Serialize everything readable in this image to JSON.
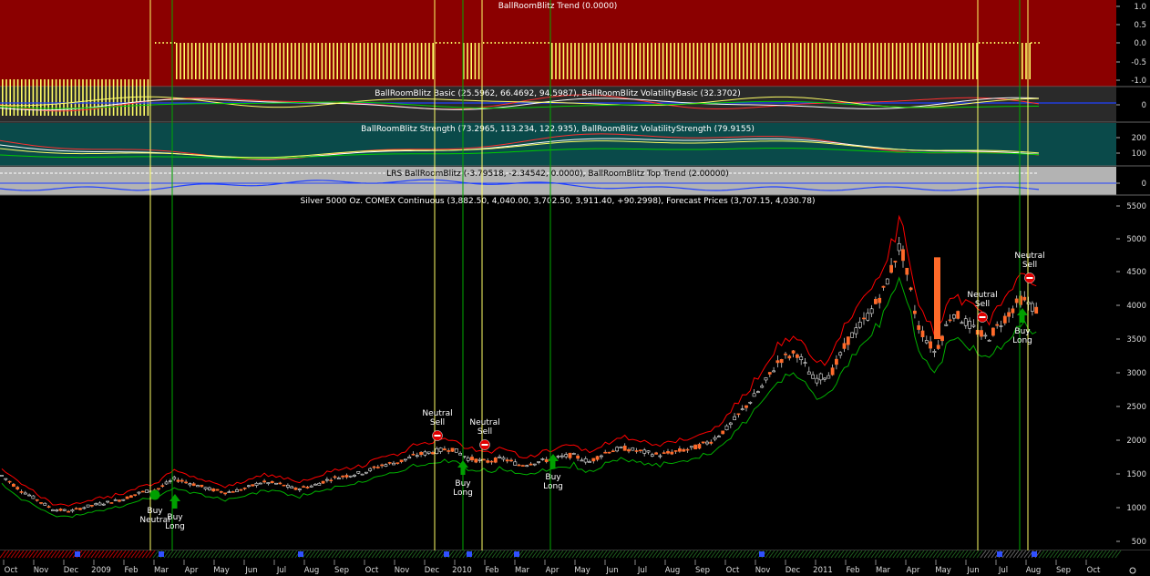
{
  "panes": {
    "trend": {
      "title": "BallRoomBlitz Trend (0.0000)",
      "ticks": [
        "1.0",
        "0.5",
        "0.0",
        "-0.5",
        "-1.0"
      ]
    },
    "basic": {
      "title": "BallRoomBlitz Basic (25.5962, 66.4692, 94.5987), BallRoomBlitz VolatilityBasic (32.3702)",
      "ticks": [
        "0"
      ]
    },
    "strength": {
      "title": "BallRoomBlitz Strength (73.2965, 113.234, 122.935), BallRoomBlitz VolatilityStrength (79.9155)",
      "ticks": [
        "200",
        "100"
      ]
    },
    "lrs": {
      "title": "LRS BallRoomBlitz (-3.79518, -2.34542, 0.0000), BallRoomBlitz Top Trend (2.00000)",
      "ticks": [
        "0"
      ]
    },
    "price": {
      "title": "Silver 5000 Oz. COMEX Continuous (3,882.50, 4,040.00, 3,702.50, 3,911.40, +90.2998), Forecast Prices (3,707.15, 4,030.78)",
      "ticks": [
        "5500",
        "5000",
        "4500",
        "4000",
        "3500",
        "3000",
        "2500",
        "2000",
        "1500",
        "1000",
        "500"
      ]
    }
  },
  "x_axis_labels": [
    "Oct",
    "Nov",
    "Dec",
    "2009",
    "Feb",
    "Mar",
    "Apr",
    "May",
    "Jun",
    "Jul",
    "Aug",
    "Sep",
    "Oct",
    "Nov",
    "Dec",
    "2010",
    "Feb",
    "Mar",
    "Apr",
    "May",
    "Jun",
    "Jul",
    "Aug",
    "Sep",
    "Oct",
    "Nov",
    "Dec",
    "2011",
    "Feb",
    "Mar",
    "Apr",
    "May",
    "Jun",
    "Jul",
    "Aug",
    "Sep",
    "Oct"
  ],
  "signals": [
    {
      "line1": "Buy",
      "line2": "Neutral",
      "type": "buy-neutral"
    },
    {
      "line1": "Buy",
      "line2": "Long",
      "type": "buy"
    },
    {
      "line1": "Neutral",
      "line2": "Sell",
      "type": "sell"
    },
    {
      "line1": "Buy",
      "line2": "Long",
      "type": "buy"
    },
    {
      "line1": "Neutral",
      "line2": "Sell",
      "type": "sell"
    },
    {
      "line1": "Buy",
      "line2": "Long",
      "type": "buy"
    },
    {
      "line1": "Neutral",
      "line2": "Sell",
      "type": "sell"
    },
    {
      "line1": "Buy",
      "line2": "Long",
      "type": "buy"
    },
    {
      "line1": "Neutral",
      "line2": "Sell",
      "type": "sell"
    }
  ],
  "colors": {
    "trend_bg": "#8b0000",
    "basic_bg": "#2a2a2a",
    "strength_bg": "#0a4a4a",
    "lrs_bg": "#b3b3b3",
    "price_bg": "#000000",
    "axis_bg": "#c0c0c0",
    "up_candle": "#e8e8e8",
    "down_candle": "#ff6a2a",
    "upper_band": "#ff0000",
    "lower_band": "#00b000",
    "vline_yellow": "#ffff66",
    "vline_green": "#00aa00"
  },
  "chart_data": {
    "type": "line",
    "title": "Silver 5000 Oz. COMEX Continuous (3,882.50, 4,040.00, 3,702.50, 3,911.40, +90.2998), Forecast Prices (3,707.15, 4,030.78)",
    "ylim": [
      400,
      5600
    ],
    "series": [
      {
        "values": [
          1500,
          1300,
          1150,
          1000,
          980,
          1050,
          1100,
          1150,
          1250,
          1300,
          1450,
          1380,
          1300,
          1250,
          1300,
          1400,
          1380,
          1300,
          1350,
          1450,
          1500,
          1550,
          1650,
          1700,
          1800,
          1850,
          1900,
          1750,
          1700,
          1750,
          1650,
          1700,
          1750,
          1800,
          1700,
          1850,
          1900,
          1850,
          1800,
          1850,
          1900,
          2000,
          2200,
          2500,
          2800,
          3200,
          3300,
          2900,
          3000,
          3500,
          3800,
          4200,
          4900,
          3700,
          3300,
          3900,
          3700,
          3500,
          3800,
          4100,
          3900
        ]
      }
    ],
    "forecast_last": [
      3707.15,
      4030.78
    ]
  }
}
